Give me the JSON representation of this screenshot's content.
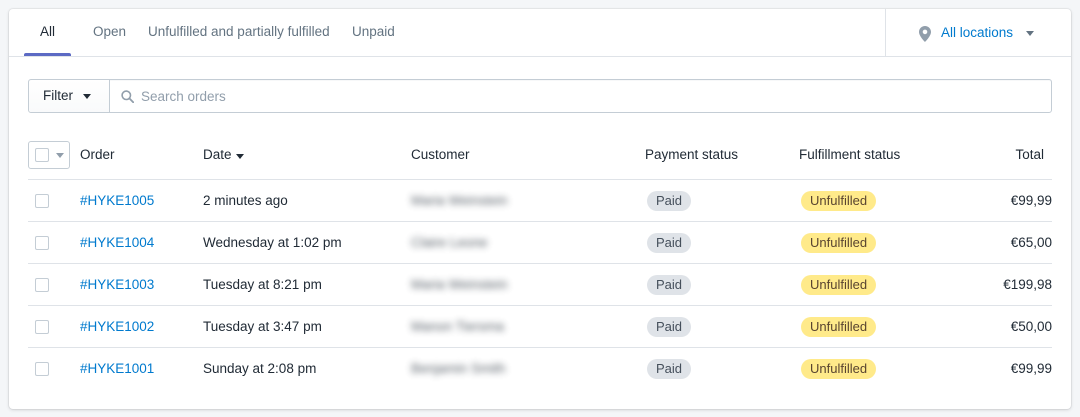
{
  "tabs": [
    {
      "label": "All",
      "active": true
    },
    {
      "label": "Open",
      "active": false
    },
    {
      "label": "Unfulfilled and partially fulfilled",
      "active": false
    },
    {
      "label": "Unpaid",
      "active": false
    }
  ],
  "location": {
    "label": "All locations",
    "icon": "map-pin-icon"
  },
  "filter": {
    "label": "Filter",
    "search_placeholder": "Search orders",
    "search_value": ""
  },
  "table": {
    "headers": {
      "order": "Order",
      "date": "Date",
      "customer": "Customer",
      "payment_status": "Payment status",
      "fulfillment_status": "Fulfillment status",
      "total": "Total"
    },
    "rows": [
      {
        "order": "#HYKE1005",
        "date": "2 minutes ago",
        "customer": "Maria Weinstein",
        "payment": "Paid",
        "fulfillment": "Unfulfilled",
        "total": "€99,99"
      },
      {
        "order": "#HYKE1004",
        "date": "Wednesday at 1:02 pm",
        "customer": "Claire Leone",
        "payment": "Paid",
        "fulfillment": "Unfulfilled",
        "total": "€65,00"
      },
      {
        "order": "#HYKE1003",
        "date": "Tuesday at 8:21 pm",
        "customer": "Maria Weinstein",
        "payment": "Paid",
        "fulfillment": "Unfulfilled",
        "total": "€199,98"
      },
      {
        "order": "#HYKE1002",
        "date": "Tuesday at 3:47 pm",
        "customer": "Manon Tiersma",
        "payment": "Paid",
        "fulfillment": "Unfulfilled",
        "total": "€50,00"
      },
      {
        "order": "#HYKE1001",
        "date": "Sunday at 2:08 pm",
        "customer": "Benjamin Smith",
        "payment": "Paid",
        "fulfillment": "Unfulfilled",
        "total": "€99,99"
      }
    ]
  },
  "colors": {
    "accent": "#5c6ac4",
    "link": "#007ace",
    "paid_badge": "#dfe3e8",
    "unfulfilled_badge": "#ffea8a"
  }
}
